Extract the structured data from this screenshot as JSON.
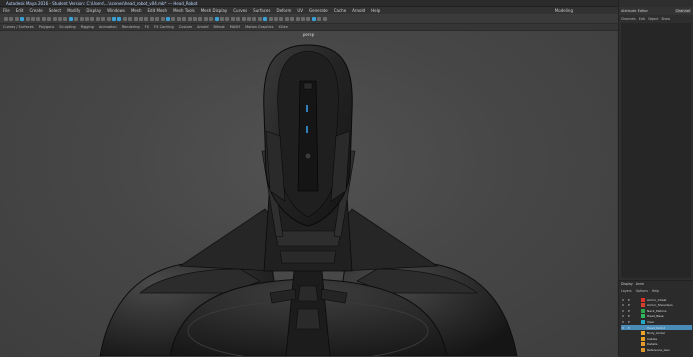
{
  "app": {
    "title": "Autodesk Maya 2016 - Student Version: C:\\Users\\...\\scenes\\head_robot_v04.mb* --- Head_Robot"
  },
  "window_buttons": [
    "–",
    "□",
    "✕"
  ],
  "menu": {
    "items": [
      "File",
      "Edit",
      "Create",
      "Select",
      "Modify",
      "Display",
      "Windows",
      "Mesh",
      "Edit Mesh",
      "Mesh Tools",
      "Mesh Display",
      "Curves",
      "Surfaces",
      "Deform",
      "UV",
      "Generate",
      "Cache",
      "Arnold",
      "Help"
    ],
    "workspace_label": "Modeling"
  },
  "shelf": {
    "tabs": [
      "Curves / Surfaces",
      "Polygons",
      "Sculpting",
      "Rigging",
      "Animation",
      "Rendering",
      "FX",
      "FX Caching",
      "Custom",
      "Arnold",
      "Bifrost",
      "MASH",
      "Motion Graphics",
      "XGen"
    ]
  },
  "viewport": {
    "camera_label": "persp"
  },
  "right_panel": {
    "top_left": "Attribute Editor",
    "top_right": "Channel",
    "tabs": [
      "Channels",
      "Edit",
      "Object",
      "Show"
    ]
  },
  "outliner": {
    "header": [
      "Display",
      "Anim"
    ],
    "subheader": [
      "Layers",
      "Options",
      "Help"
    ],
    "layers": [
      {
        "v": "V",
        "p": "P",
        "color": "#e0302a",
        "name": "Armor_Chest"
      },
      {
        "v": "V",
        "p": "P",
        "color": "#d8402e",
        "name": "Armor_Shoulders"
      },
      {
        "v": "V",
        "p": "P",
        "color": "#2aa84a",
        "name": "Neck_Pistons"
      },
      {
        "v": "V",
        "p": "P",
        "color": "#2fb860",
        "name": "Head_Base"
      },
      {
        "v": "V",
        "p": "P",
        "color": "#22aac8",
        "name": "Visor"
      },
      {
        "v": "V",
        "p": "P",
        "color": "#4a8cb8",
        "name": "Head_Robot",
        "selected": true
      },
      {
        "v": "",
        "p": "",
        "color": "#e6a22a",
        "name": "Body_Under"
      },
      {
        "v": "",
        "p": "",
        "color": "#e8a020",
        "name": "Cables"
      },
      {
        "v": "",
        "p": "",
        "color": "#e49a2c",
        "name": "Details"
      },
      {
        "v": "",
        "p": "",
        "color": "#dc962a",
        "name": "Reference_Geo"
      }
    ]
  }
}
